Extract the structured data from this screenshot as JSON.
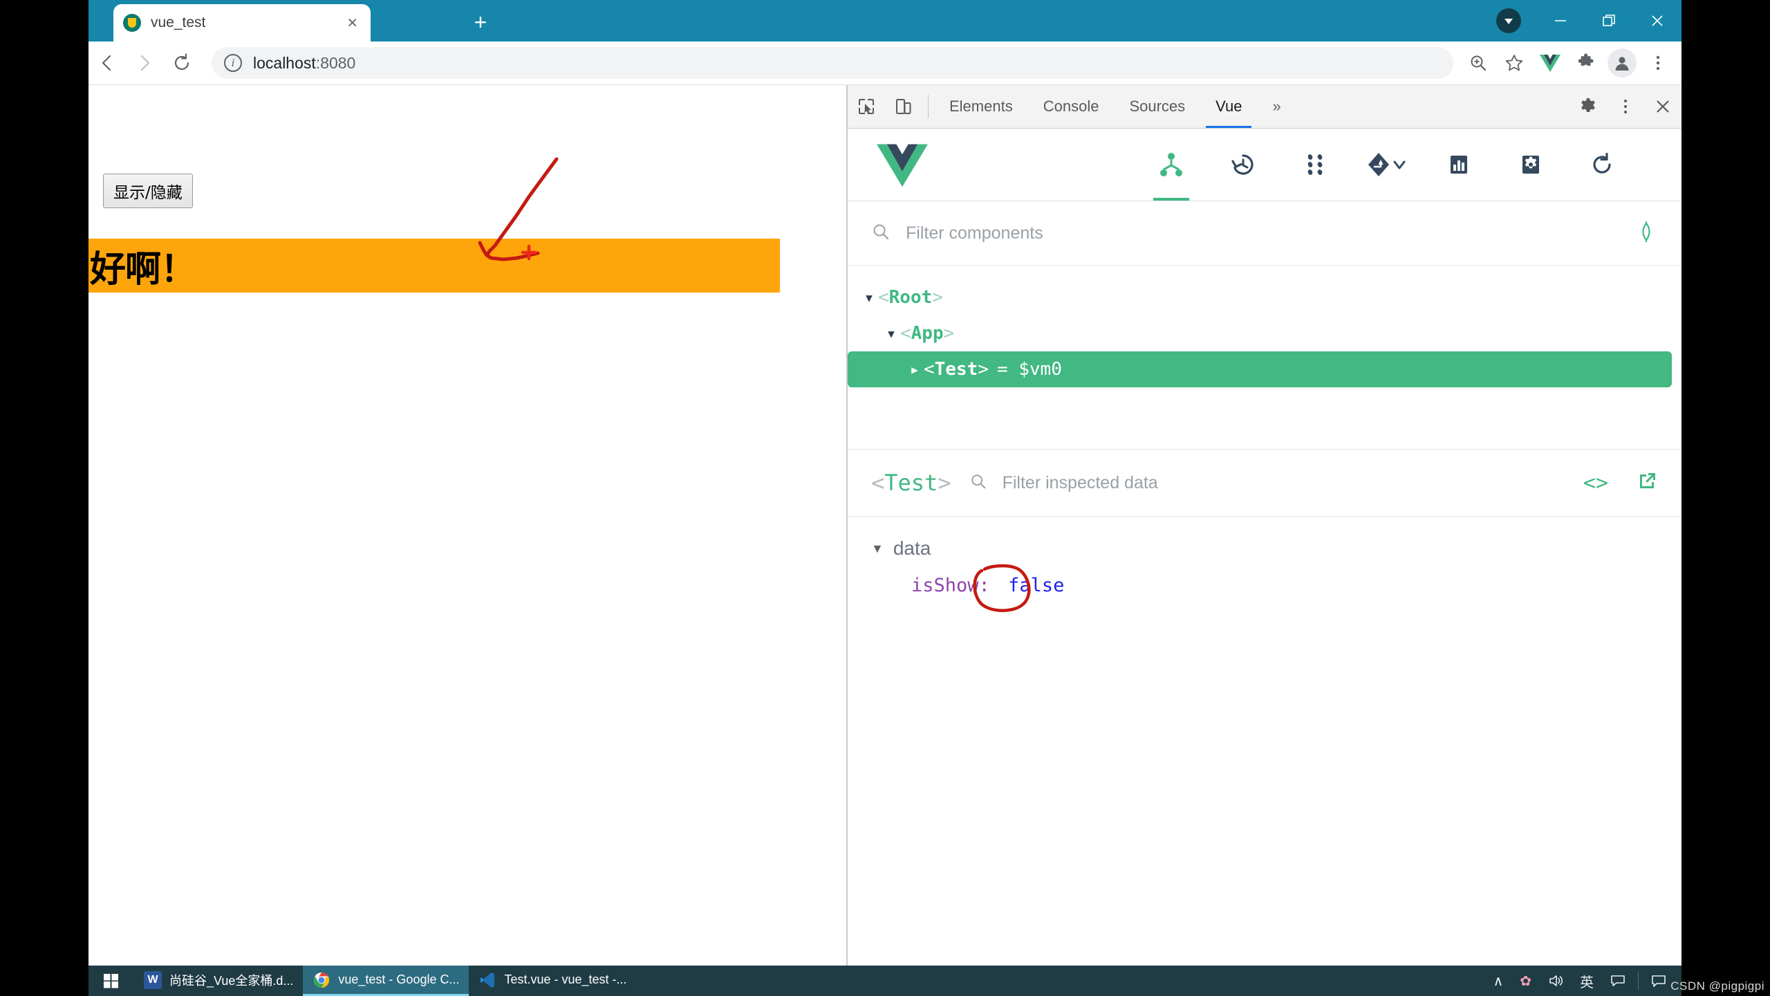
{
  "browser": {
    "tab": {
      "title": "vue_test",
      "favicon": "vue-favicon-icon",
      "close": "×"
    },
    "newtab_label": "+",
    "window_controls": {
      "badge": "▼",
      "minimize": "—",
      "maximize": "❐",
      "close": "✕"
    },
    "nav": {
      "back": "←",
      "forward": "→",
      "reload": "⟳"
    },
    "omnibox": {
      "info_glyph": "i",
      "url_host": "localhost",
      "url_port": ":8080"
    },
    "toolbar_icons": [
      "zoom-icon",
      "bookmark-star-icon",
      "vue-devtools-icon",
      "extensions-puzzle-icon",
      "profile-avatar-icon",
      "chrome-menu-icon"
    ]
  },
  "page": {
    "toggle_button": "显示/隐藏",
    "banner_text": "好啊！",
    "banner_color": "#FFA50C"
  },
  "devtools": {
    "tabs": [
      {
        "label": "Elements",
        "active": false
      },
      {
        "label": "Console",
        "active": false
      },
      {
        "label": "Sources",
        "active": false
      },
      {
        "label": "Vue",
        "active": true
      }
    ],
    "more_label": "»",
    "right_icons": [
      "settings-gear-icon",
      "devtools-menu-icon",
      "devtools-close-icon"
    ],
    "left_icons": [
      "inspect-element-icon",
      "device-toolbar-icon"
    ]
  },
  "vue_panel": {
    "toolbar_icons": [
      "components-tree-icon",
      "timeline-history-icon",
      "vuex-icon",
      "routing-icon",
      "performance-icon",
      "settings-icon",
      "refresh-icon"
    ],
    "filter_placeholder": "Filter components",
    "select_component_icon": "crosshair-target-icon",
    "tree": [
      {
        "name": "Root",
        "depth": 0,
        "caret": "▼",
        "selected": false,
        "suffix": ""
      },
      {
        "name": "App",
        "depth": 1,
        "caret": "▼",
        "selected": false,
        "suffix": ""
      },
      {
        "name": "Test",
        "depth": 2,
        "caret": "▶",
        "selected": true,
        "suffix": "= $vm0"
      }
    ],
    "inspected": {
      "component": "Test",
      "filter_placeholder": "Filter inspected data",
      "code_icon": "<>",
      "open_external_icon": "open-in-new-icon",
      "data_label": "data",
      "data_caret": "▼",
      "props": [
        {
          "key": "isShow",
          "value": "false",
          "circled": true
        }
      ]
    }
  },
  "taskbar": {
    "start_icon": "windows-start-icon",
    "tasks": [
      {
        "label": "尚硅谷_Vue全家桶.d...",
        "icon": "W",
        "icon_color": "#2b579a",
        "active": false
      },
      {
        "label": "vue_test - Google C...",
        "icon": "chrome-icon",
        "icon_color": "#ffffff",
        "active": true
      },
      {
        "label": "Test.vue - vue_test -...",
        "icon": "vscode-icon",
        "icon_color": "#1f6fb2",
        "active": false
      }
    ],
    "tray": [
      "∧",
      "✿",
      "🔊",
      "英",
      "⌨"
    ],
    "watermark": "CSDN @pigpigpi"
  }
}
